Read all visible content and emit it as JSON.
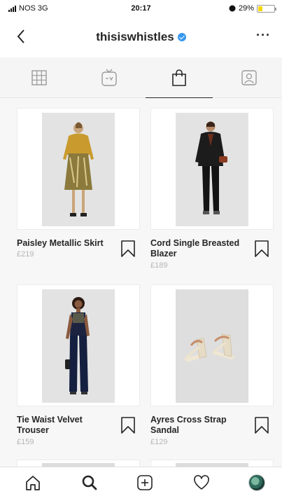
{
  "status_bar": {
    "carrier": "NOS 3G",
    "time": "20:17",
    "battery_percent": "29%",
    "battery_level": 0.29
  },
  "header": {
    "username": "thisiswhistles",
    "verified": true,
    "more_label": "···"
  },
  "tabs": [
    {
      "icon": "grid-icon",
      "active": false
    },
    {
      "icon": "igtv-icon",
      "active": false
    },
    {
      "icon": "shopping-bag-icon",
      "active": true
    },
    {
      "icon": "tagged-icon",
      "active": false
    }
  ],
  "products": [
    {
      "name": "Paisley Metallic Skirt",
      "price": "£219",
      "image": "woman-mustard-blouse-metallic-skirt"
    },
    {
      "name": "Cord Single Breasted Blazer",
      "price": "£189",
      "image": "woman-black-blazer-trousers"
    },
    {
      "name": "Tie Waist Velvet Trouser",
      "price": "£159",
      "image": "woman-navy-velvet-jumpsuit"
    },
    {
      "name": "Ayres Cross Strap Sandal",
      "price": "£129",
      "image": "cream-block-heel-sandals"
    }
  ],
  "bottom_nav": [
    {
      "icon": "home-icon"
    },
    {
      "icon": "search-icon"
    },
    {
      "icon": "add-post-icon"
    },
    {
      "icon": "heart-icon"
    },
    {
      "icon": "profile-avatar"
    }
  ],
  "colors": {
    "verified_badge": "#3897f0",
    "battery_fill": "#f5d800",
    "price_text": "#b5b5b5"
  }
}
